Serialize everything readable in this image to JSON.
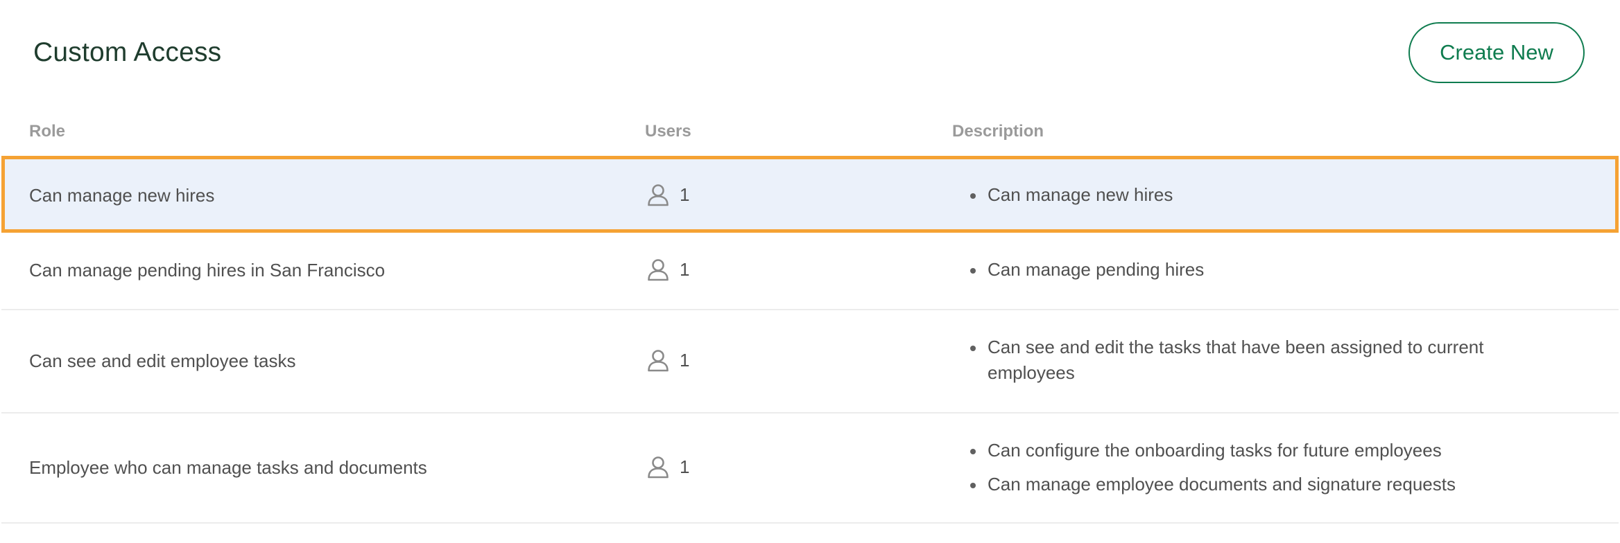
{
  "header": {
    "title": "Custom Access",
    "create_label": "Create New"
  },
  "table": {
    "columns": {
      "role": "Role",
      "users": "Users",
      "description": "Description"
    },
    "rows": [
      {
        "role": "Can manage new hires",
        "users": "1",
        "description": [
          "Can manage new hires"
        ],
        "selected": true
      },
      {
        "role": "Can manage pending hires in San Francisco",
        "users": "1",
        "description": [
          "Can manage pending hires"
        ],
        "selected": false
      },
      {
        "role": "Can see and edit employee tasks",
        "users": "1",
        "description": [
          "Can see and edit the tasks that have been assigned to current employees"
        ],
        "selected": false
      },
      {
        "role": "Employee who can manage tasks and documents",
        "users": "1",
        "description": [
          "Can configure the onboarding tasks for future employees",
          "Can manage employee documents and signature requests"
        ],
        "selected": false
      }
    ]
  },
  "icons": {
    "users": "user-icon"
  },
  "colors": {
    "accent_green": "#0f7c4f",
    "selection_border": "#f5a234",
    "selection_background": "#ebf1fa"
  }
}
